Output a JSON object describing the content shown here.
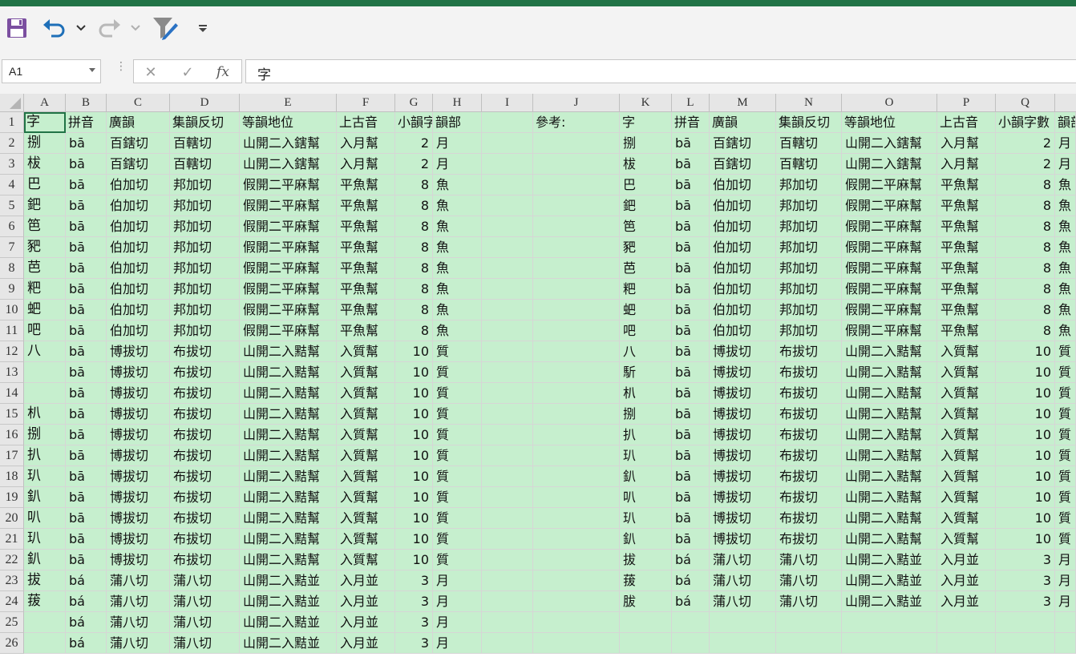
{
  "qat": {
    "save": "save-icon",
    "undo": "undo-icon",
    "redo": "redo-icon",
    "filter": "filter-icon",
    "customize": "customize-qat-icon"
  },
  "formula_bar": {
    "name_box": "A1",
    "cancel_symbol": "✕",
    "enter_symbol": "✓",
    "fx_symbol": "fx",
    "content": "字"
  },
  "columns": [
    "A",
    "B",
    "C",
    "D",
    "E",
    "F",
    "G",
    "H",
    "I",
    "J",
    "K",
    "L",
    "M",
    "N",
    "O",
    "P",
    "Q"
  ],
  "rows": [
    "1",
    "2",
    "3",
    "4",
    "5",
    "6",
    "7",
    "8",
    "9",
    "10",
    "11",
    "12",
    "13",
    "14",
    "15",
    "16",
    "17",
    "18",
    "19",
    "20",
    "21",
    "22",
    "23",
    "24",
    "25",
    "26"
  ],
  "left_table": {
    "headers": [
      "字",
      "拼音",
      "廣韻",
      "集韻反切",
      "等韻地位",
      "上古音",
      "小韻字數",
      "韻部"
    ],
    "rows": [
      [
        "捌",
        "bā",
        "百鎋切",
        "百轄切",
        "山開二入鎋幫",
        "入月幫",
        "2",
        "月"
      ],
      [
        "柭",
        "bā",
        "百鎋切",
        "百轄切",
        "山開二入鎋幫",
        "入月幫",
        "2",
        "月"
      ],
      [
        "巴",
        "bā",
        "伯加切",
        "邦加切",
        "假開二平麻幫",
        "平魚幫",
        "8",
        "魚"
      ],
      [
        "鈀",
        "bā",
        "伯加切",
        "邦加切",
        "假開二平麻幫",
        "平魚幫",
        "8",
        "魚"
      ],
      [
        "笆",
        "bā",
        "伯加切",
        "邦加切",
        "假開二平麻幫",
        "平魚幫",
        "8",
        "魚"
      ],
      [
        "豝",
        "bā",
        "伯加切",
        "邦加切",
        "假開二平麻幫",
        "平魚幫",
        "8",
        "魚"
      ],
      [
        "芭",
        "bā",
        "伯加切",
        "邦加切",
        "假開二平麻幫",
        "平魚幫",
        "8",
        "魚"
      ],
      [
        "粑",
        "bā",
        "伯加切",
        "邦加切",
        "假開二平麻幫",
        "平魚幫",
        "8",
        "魚"
      ],
      [
        "蚆",
        "bā",
        "伯加切",
        "邦加切",
        "假開二平麻幫",
        "平魚幫",
        "8",
        "魚"
      ],
      [
        "吧",
        "bā",
        "伯加切",
        "邦加切",
        "假開二平麻幫",
        "平魚幫",
        "8",
        "魚"
      ],
      [
        "八",
        "bā",
        "博拔切",
        "布拔切",
        "山開二入黠幫",
        "入質幫",
        "10",
        "質"
      ],
      [
        "",
        "bā",
        "博拔切",
        "布拔切",
        "山開二入黠幫",
        "入質幫",
        "10",
        "質"
      ],
      [
        "",
        "bā",
        "博拔切",
        "布拔切",
        "山開二入黠幫",
        "入質幫",
        "10",
        "質"
      ],
      [
        "朳",
        "bā",
        "博拔切",
        "布拔切",
        "山開二入黠幫",
        "入質幫",
        "10",
        "質"
      ],
      [
        "捌",
        "bā",
        "博拔切",
        "布拔切",
        "山開二入黠幫",
        "入質幫",
        "10",
        "質"
      ],
      [
        "扒",
        "bā",
        "博拔切",
        "布拔切",
        "山開二入黠幫",
        "入質幫",
        "10",
        "質"
      ],
      [
        "玐",
        "bā",
        "博拔切",
        "布拔切",
        "山開二入黠幫",
        "入質幫",
        "10",
        "質"
      ],
      [
        "釟",
        "bā",
        "博拔切",
        "布拔切",
        "山開二入黠幫",
        "入質幫",
        "10",
        "質"
      ],
      [
        "叭",
        "bā",
        "博拔切",
        "布拔切",
        "山開二入黠幫",
        "入質幫",
        "10",
        "質"
      ],
      [
        "玐",
        "bā",
        "博拔切",
        "布拔切",
        "山開二入黠幫",
        "入質幫",
        "10",
        "質"
      ],
      [
        "釟",
        "bā",
        "博拔切",
        "布拔切",
        "山開二入黠幫",
        "入質幫",
        "10",
        "質"
      ],
      [
        "拔",
        "bá",
        "蒲八切",
        "蒲八切",
        "山開二入黠並",
        "入月並",
        "3",
        "月"
      ],
      [
        "菝",
        "bá",
        "蒲八切",
        "蒲八切",
        "山開二入黠並",
        "入月並",
        "3",
        "月"
      ],
      [
        "",
        "bá",
        "蒲八切",
        "蒲八切",
        "山開二入黠並",
        "入月並",
        "3",
        "月"
      ],
      [
        "",
        "bá",
        "蒲八切",
        "蒲八切",
        "山開二入黠並",
        "入月並",
        "3",
        "月"
      ]
    ]
  },
  "reference_label": "參考:",
  "right_table": {
    "headers": [
      "字",
      "拼音",
      "廣韻",
      "集韻反切",
      "等韻地位",
      "上古音",
      "小韻字數",
      "韻部"
    ],
    "rows": [
      [
        "捌",
        "bā",
        "百鎋切",
        "百轄切",
        "山開二入鎋幫",
        "入月幫",
        "2",
        "月"
      ],
      [
        "柭",
        "bā",
        "百鎋切",
        "百轄切",
        "山開二入鎋幫",
        "入月幫",
        "2",
        "月"
      ],
      [
        "巴",
        "bā",
        "伯加切",
        "邦加切",
        "假開二平麻幫",
        "平魚幫",
        "8",
        "魚"
      ],
      [
        "鈀",
        "bā",
        "伯加切",
        "邦加切",
        "假開二平麻幫",
        "平魚幫",
        "8",
        "魚"
      ],
      [
        "笆",
        "bā",
        "伯加切",
        "邦加切",
        "假開二平麻幫",
        "平魚幫",
        "8",
        "魚"
      ],
      [
        "豝",
        "bā",
        "伯加切",
        "邦加切",
        "假開二平麻幫",
        "平魚幫",
        "8",
        "魚"
      ],
      [
        "芭",
        "bā",
        "伯加切",
        "邦加切",
        "假開二平麻幫",
        "平魚幫",
        "8",
        "魚"
      ],
      [
        "粑",
        "bā",
        "伯加切",
        "邦加切",
        "假開二平麻幫",
        "平魚幫",
        "8",
        "魚"
      ],
      [
        "蚆",
        "bā",
        "伯加切",
        "邦加切",
        "假開二平麻幫",
        "平魚幫",
        "8",
        "魚"
      ],
      [
        "吧",
        "bā",
        "伯加切",
        "邦加切",
        "假開二平麻幫",
        "平魚幫",
        "8",
        "魚"
      ],
      [
        "八",
        "bā",
        "博拔切",
        "布拔切",
        "山開二入黠幫",
        "入質幫",
        "10",
        "質"
      ],
      [
        "馸",
        "bā",
        "博拔切",
        "布拔切",
        "山開二入黠幫",
        "入質幫",
        "10",
        "質"
      ],
      [
        "朳",
        "bā",
        "博拔切",
        "布拔切",
        "山開二入黠幫",
        "入質幫",
        "10",
        "質"
      ],
      [
        "捌",
        "bā",
        "博拔切",
        "布拔切",
        "山開二入黠幫",
        "入質幫",
        "10",
        "質"
      ],
      [
        "扒",
        "bā",
        "博拔切",
        "布拔切",
        "山開二入黠幫",
        "入質幫",
        "10",
        "質"
      ],
      [
        "玐",
        "bā",
        "博拔切",
        "布拔切",
        "山開二入黠幫",
        "入質幫",
        "10",
        "質"
      ],
      [
        "釟",
        "bā",
        "博拔切",
        "布拔切",
        "山開二入黠幫",
        "入質幫",
        "10",
        "質"
      ],
      [
        "叭",
        "bā",
        "博拔切",
        "布拔切",
        "山開二入黠幫",
        "入質幫",
        "10",
        "質"
      ],
      [
        "玐",
        "bā",
        "博拔切",
        "布拔切",
        "山開二入黠幫",
        "入質幫",
        "10",
        "質"
      ],
      [
        "釟",
        "bā",
        "博拔切",
        "布拔切",
        "山開二入黠幫",
        "入質幫",
        "10",
        "質"
      ],
      [
        "拔",
        "bá",
        "蒲八切",
        "蒲八切",
        "山開二入黠並",
        "入月並",
        "3",
        "月"
      ],
      [
        "菝",
        "bá",
        "蒲八切",
        "蒲八切",
        "山開二入黠並",
        "入月並",
        "3",
        "月"
      ],
      [
        "胈",
        "bá",
        "蒲八切",
        "蒲八切",
        "山開二入黠並",
        "入月並",
        "3",
        "月"
      ]
    ]
  },
  "colors": {
    "accent": "#217346",
    "cell_fill": "#c6efce",
    "header_bg": "#e6e6e6"
  }
}
